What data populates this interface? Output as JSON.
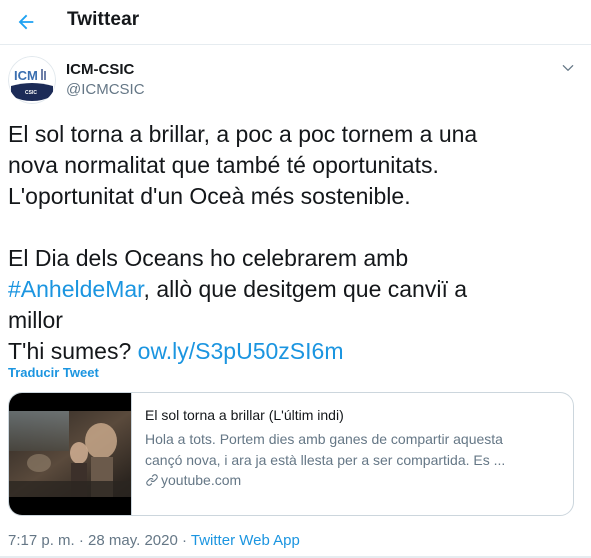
{
  "header": {
    "title": "Twittear",
    "back_icon": "arrow-left-icon",
    "accent": "#1da1f2"
  },
  "author": {
    "name": "ICM-CSIC",
    "handle": "@ICMCSIC",
    "avatar_text": "ICM",
    "avatar_subtext": "CSIC"
  },
  "tweet": {
    "line1": "El sol torna a brillar, a poc a poc tornem a una",
    "line2": "nova normalitat que també té oportunitats.",
    "line3": "L'oportunitat d'un Oceà més sostenible.",
    "line4": "El Dia dels Oceans ho celebrarem amb",
    "hashtag": "#AnheldeMar",
    "line5_rest": ", allò que desitgem que canviï a",
    "line6": "millor",
    "line7": "T'hi sumes? ",
    "link": "ow.ly/S3pU50zSI6m"
  },
  "translate_label": "Traducir Tweet",
  "card": {
    "title": "El sol torna a brillar (L'últim indi)",
    "desc1": "Hola a tots. Portem dies amb ganes de compartir aquesta",
    "desc2": "cançó nova, i ara ja està llesta per a ser compartida. Es ...",
    "domain": "youtube.com"
  },
  "meta": {
    "time": "7:17 p. m.",
    "sep1": " · ",
    "date": "28 may. 2020",
    "sep2": " · ",
    "app": "Twitter Web App"
  },
  "colors": {
    "link": "#1b95e0",
    "text": "#14171a",
    "muted": "#657786",
    "border": "#e6ecf0"
  }
}
